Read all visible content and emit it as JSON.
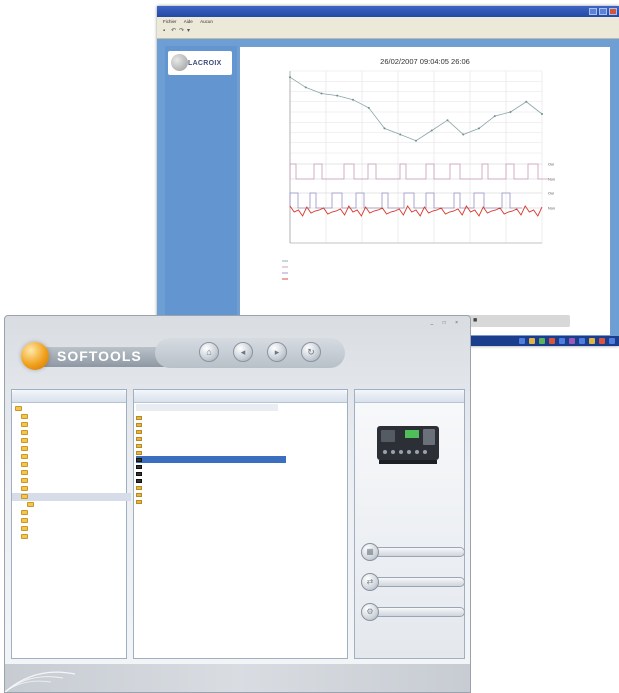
{
  "back_window": {
    "title": "",
    "menu": [
      "Fichier",
      "Aide",
      "Aucun"
    ],
    "toolbar_icons": [
      "save-icon",
      "undo-icon",
      "redo-icon",
      "print-icon"
    ],
    "brand": "LACROIX",
    "side_links": [
      "",
      "",
      "",
      ""
    ],
    "chart_tools": "⊕ 🔍 🔍 ▤ ✱ ▼ ■"
  },
  "chart_data": {
    "type": "line",
    "title": "26/02/2007 09:04:05 26:06",
    "x": [
      "",
      "",
      "",
      "",
      "",
      "",
      "",
      ""
    ],
    "series": [
      {
        "name": "",
        "values": [
          8.7,
          8.2,
          7.9,
          7.8,
          7.6,
          7.2,
          6.2,
          5.9,
          5.6,
          6.1,
          6.6,
          5.9,
          6.2,
          6.8,
          7.0,
          7.5,
          6.9
        ]
      }
    ],
    "ylim": [
      5,
      9
    ],
    "states": [
      {
        "name": "Etat",
        "high": "Oui",
        "low": "Non"
      }
    ],
    "legend": [
      "",
      "",
      "",
      ""
    ]
  },
  "front_window": {
    "window_controls": "_ □ ×",
    "brand": "SOFTOOLS",
    "brand_sub": "",
    "nav_icons": [
      "home-icon",
      "arrow-left-icon",
      "arrow-right-icon",
      "refresh-icon"
    ],
    "panels": {
      "installations": {
        "title": "",
        "items": [
          {
            "label": "",
            "level": 0
          },
          {
            "label": "",
            "level": 1
          },
          {
            "label": "",
            "level": 1
          },
          {
            "label": "",
            "level": 1
          },
          {
            "label": "",
            "level": 1
          },
          {
            "label": "",
            "level": 1
          },
          {
            "label": "",
            "level": 1
          },
          {
            "label": "",
            "level": 1
          },
          {
            "label": "",
            "level": 1
          },
          {
            "label": "",
            "level": 1
          },
          {
            "label": "",
            "level": 1
          },
          {
            "label": "",
            "level": 1
          },
          {
            "label": "",
            "level": 2
          },
          {
            "label": "",
            "level": 1
          },
          {
            "label": "",
            "level": 1
          },
          {
            "label": "",
            "level": 1
          },
          {
            "label": "",
            "level": 1
          }
        ]
      },
      "rtus": {
        "title": "",
        "col_label": "",
        "col_count": "",
        "items": [
          {
            "label": "",
            "count": "",
            "type": "folder"
          },
          {
            "label": "",
            "count": "",
            "type": "folder"
          },
          {
            "label": "",
            "count": "",
            "type": "folder"
          },
          {
            "label": "",
            "count": "",
            "type": "folder"
          },
          {
            "label": "",
            "count": "",
            "type": "folder"
          },
          {
            "label": "",
            "count": "",
            "type": "folder"
          },
          {
            "label": "",
            "count": "",
            "type": "device"
          },
          {
            "label": "",
            "count": "",
            "type": "device"
          },
          {
            "label": "",
            "count": "",
            "type": "device"
          },
          {
            "label": "",
            "count": "",
            "type": "device"
          },
          {
            "label": "",
            "count": "",
            "type": "folder"
          },
          {
            "label": "",
            "count": "",
            "type": "folder"
          },
          {
            "label": "",
            "count": "",
            "type": "folder"
          }
        ]
      },
      "selected": {
        "title": "",
        "name": "",
        "date": "",
        "buttons": [
          "",
          "",
          ""
        ]
      }
    },
    "footer_text": ""
  }
}
